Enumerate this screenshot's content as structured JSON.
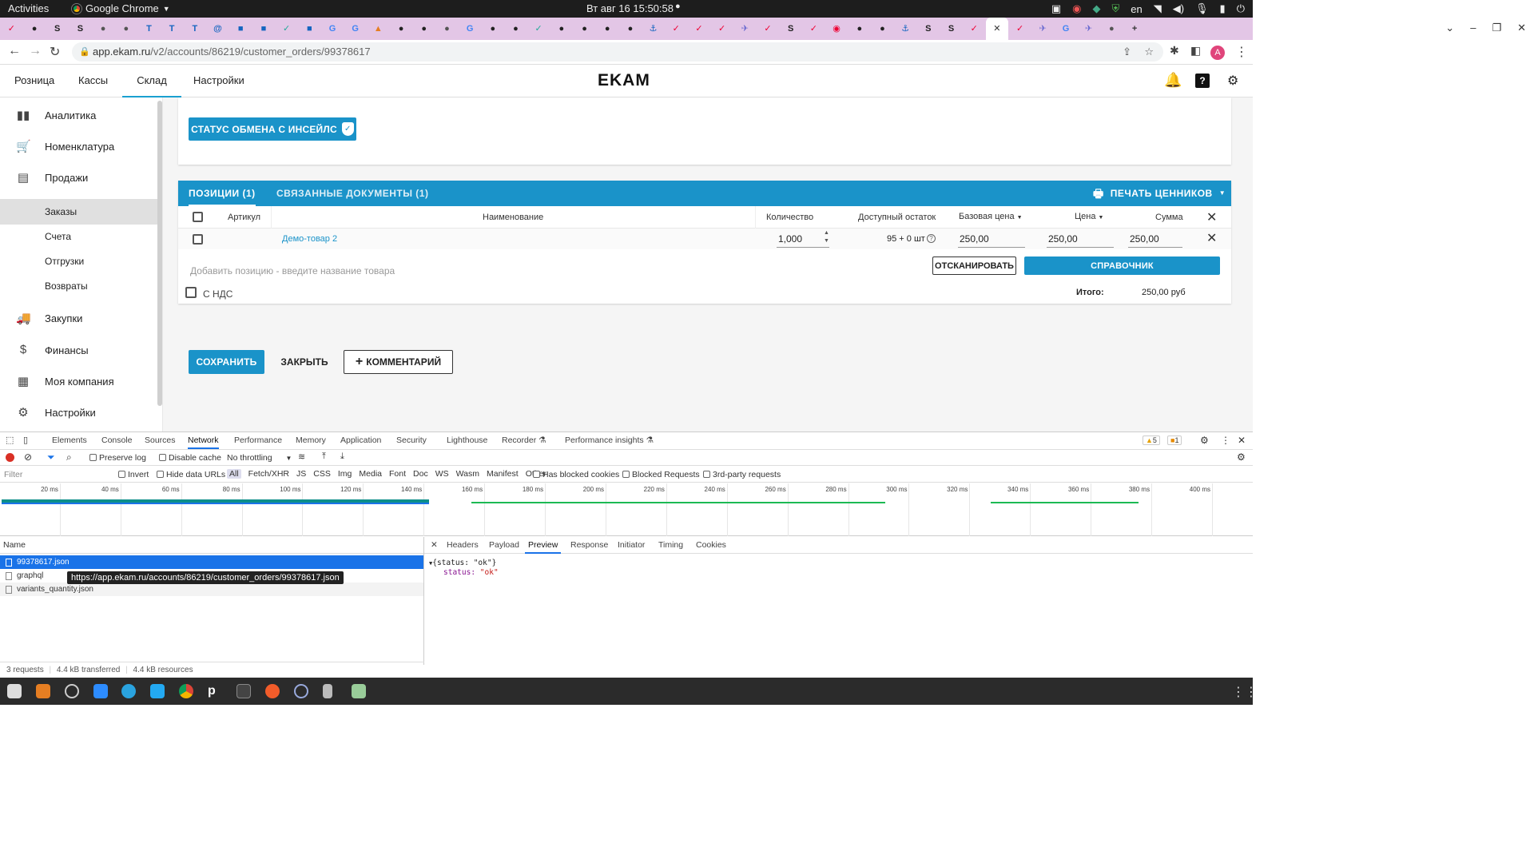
{
  "system_bar": {
    "activities": "Activities",
    "app_name": "Google Chrome",
    "clock": "Вт авг 16  15:50:58",
    "lang": "en"
  },
  "browser": {
    "url_host": "app.ekam.ru",
    "url_path": "/v2/accounts/86219/customer_orders/99378617",
    "avatar_letter": "A"
  },
  "app": {
    "logo": "EKAM",
    "top_nav": [
      "Розница",
      "Кассы",
      "Склад",
      "Настройки"
    ],
    "top_nav_active": "Склад",
    "accent_color": "#1a93c9"
  },
  "sidebar": {
    "items": [
      {
        "label": "Аналитика",
        "icon": "bar-chart-icon"
      },
      {
        "label": "Номенклатура",
        "icon": "cart-icon"
      },
      {
        "label": "Продажи",
        "icon": "store-icon"
      },
      {
        "label": "Заказы",
        "sub": true,
        "active": true
      },
      {
        "label": "Счета",
        "sub": true
      },
      {
        "label": "Отгрузки",
        "sub": true
      },
      {
        "label": "Возвраты",
        "sub": true
      },
      {
        "label": "Закупки",
        "icon": "truck-icon"
      },
      {
        "label": "Финансы",
        "icon": "dollar-icon"
      },
      {
        "label": "Моя компания",
        "icon": "building-icon"
      },
      {
        "label": "Настройки",
        "icon": "gear-icon"
      }
    ]
  },
  "order": {
    "exchange_status_button": "СТАТУС ОБМЕНА С ИНСЕЙЛС",
    "tabs": [
      "ПОЗИЦИИ (1)",
      "СВЯЗАННЫЕ ДОКУМЕНТЫ (1)"
    ],
    "print_labels": "ПЕЧАТЬ ЦЕННИКОВ",
    "columns": {
      "article": "Артикул",
      "name": "Наименование",
      "quantity": "Количество",
      "available": "Доступный остаток",
      "base_price": "Базовая цена",
      "price": "Цена",
      "sum": "Сумма"
    },
    "rows": [
      {
        "article": "",
        "name": "Демо-товар 2",
        "quantity": "1,000",
        "available": "95 + 0 шт",
        "base_price": "250,00",
        "price": "250,00",
        "sum": "250,00"
      }
    ],
    "add_position_placeholder": "Добавить позицию - введите название товара",
    "scan_button": "ОТСКАНИРОВАТЬ",
    "catalog_button": "СПРАВОЧНИК",
    "vat_label": "С НДС",
    "total_label": "Итого:",
    "total_value": "250,00 руб",
    "save_button": "СОХРАНИТЬ",
    "close_button": "ЗАКРЫТЬ",
    "comment_button": "КОММЕНТАРИЙ"
  },
  "devtools": {
    "tabs": [
      "Elements",
      "Console",
      "Sources",
      "Network",
      "Performance",
      "Memory",
      "Application",
      "Security",
      "Lighthouse",
      "Recorder",
      "Performance insights"
    ],
    "active_tab": "Network",
    "warnings": "5",
    "issues": "1",
    "preserve_log": "Preserve log",
    "disable_cache": "Disable cache",
    "throttling": "No throttling",
    "filter_placeholder": "Filter",
    "filter_options": [
      "Invert",
      "Hide data URLs"
    ],
    "type_filters": [
      "All",
      "Fetch/XHR",
      "JS",
      "CSS",
      "Img",
      "Media",
      "Font",
      "Doc",
      "WS",
      "Wasm",
      "Manifest",
      "Other"
    ],
    "extra_filters": [
      "Has blocked cookies",
      "Blocked Requests",
      "3rd-party requests"
    ],
    "timeline_ticks": [
      "20 ms",
      "40 ms",
      "60 ms",
      "80 ms",
      "100 ms",
      "120 ms",
      "140 ms",
      "160 ms",
      "180 ms",
      "200 ms",
      "220 ms",
      "240 ms",
      "260 ms",
      "280 ms",
      "300 ms",
      "320 ms",
      "340 ms",
      "360 ms",
      "380 ms",
      "400 ms"
    ],
    "name_header": "Name",
    "requests": [
      "99378617.json",
      "graphql",
      "variants_quantity.json"
    ],
    "tooltip": "https://app.ekam.ru/accounts/86219/customer_orders/99378617.json",
    "detail_tabs": [
      "Headers",
      "Payload",
      "Preview",
      "Response",
      "Initiator",
      "Timing",
      "Cookies"
    ],
    "detail_active": "Preview",
    "preview_root": "{status: \"ok\"}",
    "preview_key": "status",
    "preview_value": "\"ok\"",
    "summary": [
      "3 requests",
      "4.4 kB transferred",
      "4.4 kB resources"
    ]
  }
}
